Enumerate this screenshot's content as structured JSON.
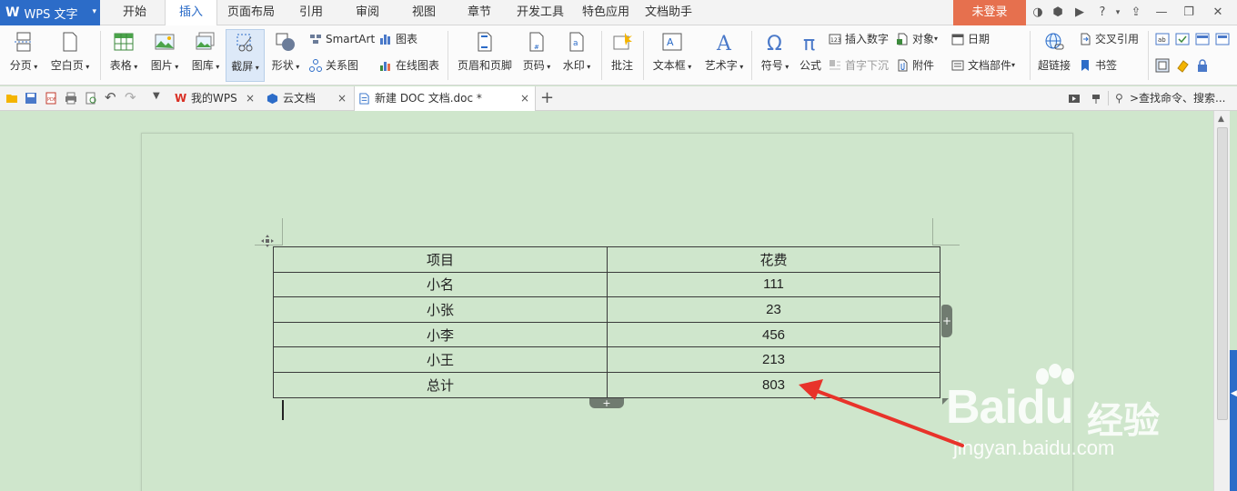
{
  "app": {
    "title": "WPS 文字"
  },
  "menu": {
    "tabs": [
      "开始",
      "插入",
      "页面布局",
      "引用",
      "审阅",
      "视图",
      "章节",
      "开发工具",
      "特色应用",
      "文档助手"
    ],
    "active_tab": "插入",
    "login": "未登录",
    "help": "?"
  },
  "ribbon": {
    "page_break": "分页",
    "blank_page": "空白页",
    "table": "表格",
    "picture": "图片",
    "gallery": "图库",
    "screenshot": "截屏",
    "shapes": "形状",
    "smartart": "SmartArt",
    "chart": "图表",
    "relation": "关系图",
    "online_chart": "在线图表",
    "header_footer": "页眉和页脚",
    "page_number": "页码",
    "watermark": "水印",
    "comment": "批注",
    "textbox": "文本框",
    "wordart": "艺术字",
    "symbol": "符号",
    "formula": "公式",
    "insert_number": "插入数字",
    "object": "对象",
    "date": "日期",
    "drop_cap": "首字下沉",
    "attachment": "附件",
    "doc_parts": "文档部件",
    "hyperlink": "超链接",
    "cross_ref": "交叉引用",
    "bookmark": "书签"
  },
  "tabs_bar": {
    "my_wps": "我的WPS",
    "cloud_docs": "云文档",
    "document": "新建 DOC 文档.doc *",
    "close": "×",
    "search": ">查找命令、搜索..."
  },
  "table": {
    "header": [
      "项目",
      "花费"
    ],
    "rows": [
      [
        "小名",
        "111"
      ],
      [
        "小张",
        "23"
      ],
      [
        "小李",
        "456"
      ],
      [
        "小王",
        "213"
      ],
      [
        "总计",
        "803"
      ]
    ]
  },
  "watermark": {
    "brand": "Baidu",
    "cn": "经验",
    "url": "jingyan.baidu.com"
  },
  "colors": {
    "accent": "#2c6cc8",
    "login": "#e6704e",
    "page_bg": "#cfe6cc",
    "arrow": "#e8332a"
  }
}
